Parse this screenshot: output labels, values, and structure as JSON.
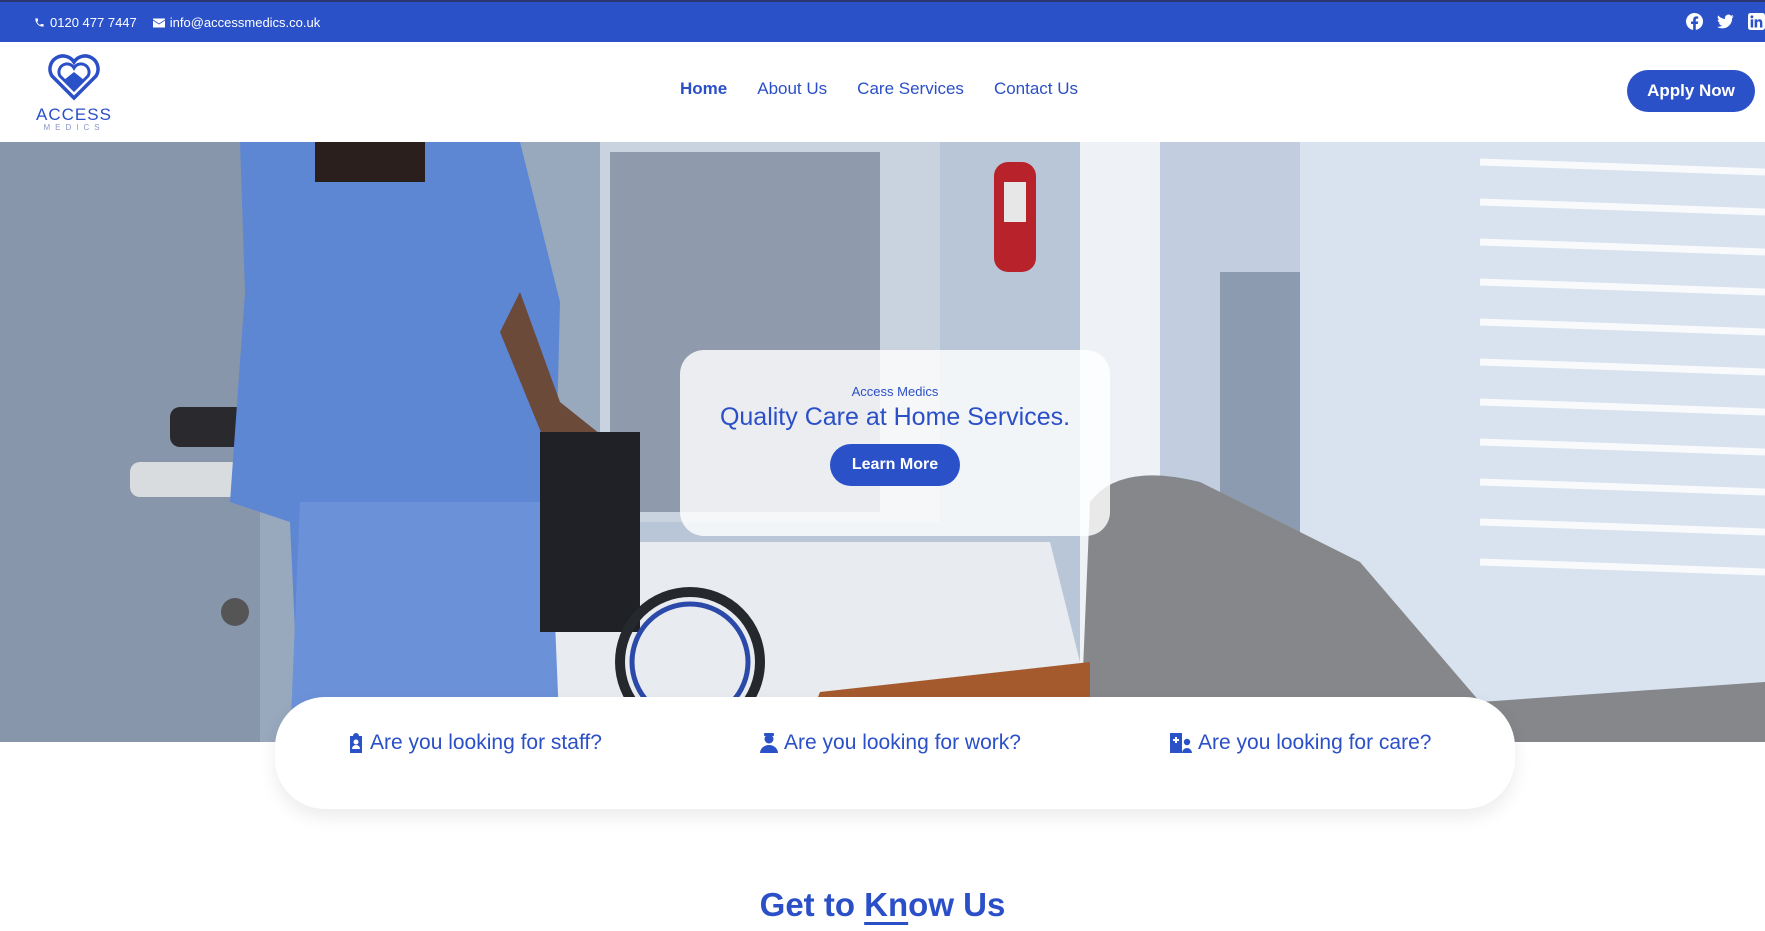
{
  "topbar": {
    "phone": "0120 477 7447",
    "email": "info@accessmedics.co.uk",
    "social_icons": [
      "facebook-icon",
      "twitter-icon",
      "linkedin-icon"
    ]
  },
  "logo": {
    "word": "ACCESS",
    "sub": "MEDICS"
  },
  "nav": {
    "items": [
      {
        "label": "Home",
        "active": true
      },
      {
        "label": "About Us"
      },
      {
        "label": "Care Services"
      },
      {
        "label": "Contact Us"
      }
    ],
    "apply_label": "Apply Now"
  },
  "hero": {
    "eyebrow": "Access Medics",
    "headline": "Quality Care at Home Services.",
    "button_label": "Learn More"
  },
  "questions": [
    {
      "label": "Are you looking for staff?",
      "icon": "clipboard-user-icon"
    },
    {
      "label": "Are you looking for work?",
      "icon": "user-nurse-icon"
    },
    {
      "label": "Are you looking for care?",
      "icon": "hospital-user-icon"
    }
  ],
  "section": {
    "title_part1": "Get to ",
    "title_k": "Kn",
    "title_part2": "ow Us"
  },
  "colors": {
    "brand": "#2b51c9",
    "text_blue": "#2b4fc7",
    "white": "#ffffff"
  }
}
